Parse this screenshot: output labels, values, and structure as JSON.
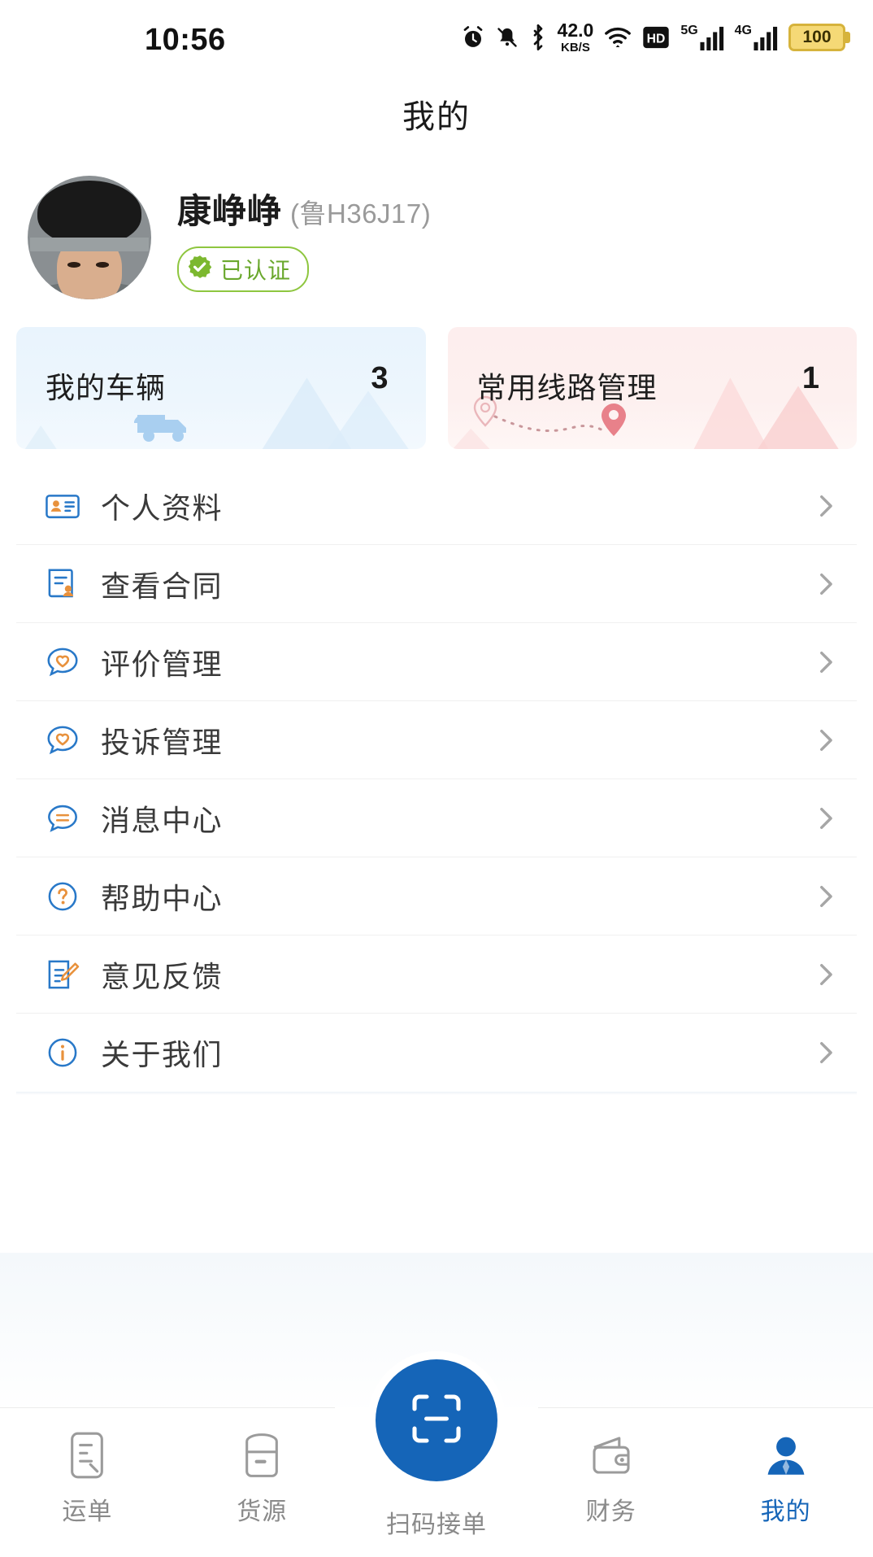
{
  "status_bar": {
    "time": "10:56",
    "network_speed_value": "42.0",
    "network_speed_unit": "KB/S",
    "hd_label": "HD",
    "signal_1_label": "5G",
    "signal_2_label": "4G",
    "battery_percent": "100",
    "icons": [
      "alarm-icon",
      "mute-bell-icon",
      "bluetooth-icon",
      "wifi-icon",
      "hd-icon",
      "signal-5g-icon",
      "signal-4g-icon",
      "battery-icon"
    ]
  },
  "header": {
    "title": "我的"
  },
  "profile": {
    "name": "康峥峥",
    "plate": "(鲁H36J17)",
    "verified_label": "已认证",
    "verified_color": "#7cb82f",
    "avatar_alt": "用户头像"
  },
  "stat_cards": [
    {
      "label": "我的车辆",
      "value": "3",
      "theme": "blue",
      "bg_color": "#eaf4fd",
      "accent_color": "#a9cff0",
      "decoration": "truck-icon"
    },
    {
      "label": "常用线路管理",
      "value": "1",
      "theme": "pink",
      "bg_color": "#fdeeee",
      "accent_color": "#e8818a",
      "decoration": "route-pins-icon"
    }
  ],
  "menu": {
    "items": [
      {
        "label": "个人资料",
        "icon": "id-card-icon"
      },
      {
        "label": "查看合同",
        "icon": "contract-stamp-icon"
      },
      {
        "label": "评价管理",
        "icon": "review-heart-bubble-icon"
      },
      {
        "label": "投诉管理",
        "icon": "complaint-heart-bubble-icon"
      },
      {
        "label": "消息中心",
        "icon": "message-bubble-icon"
      },
      {
        "label": "帮助中心",
        "icon": "question-circle-icon"
      },
      {
        "label": "意见反馈",
        "icon": "feedback-edit-icon"
      },
      {
        "label": "关于我们",
        "icon": "info-circle-icon"
      }
    ],
    "chevron_icon": "chevron-right-icon"
  },
  "tabbar": {
    "active_color": "#1565b8",
    "inactive_color": "#8a8a8a",
    "items": [
      {
        "label": "运单",
        "icon": "waybill-icon",
        "active": false
      },
      {
        "label": "货源",
        "icon": "cargo-icon",
        "active": false
      },
      {
        "label": "扫码接单",
        "icon": "scan-icon",
        "active": false,
        "center": true
      },
      {
        "label": "财务",
        "icon": "wallet-icon",
        "active": false
      },
      {
        "label": "我的",
        "icon": "user-icon",
        "active": true
      }
    ]
  }
}
